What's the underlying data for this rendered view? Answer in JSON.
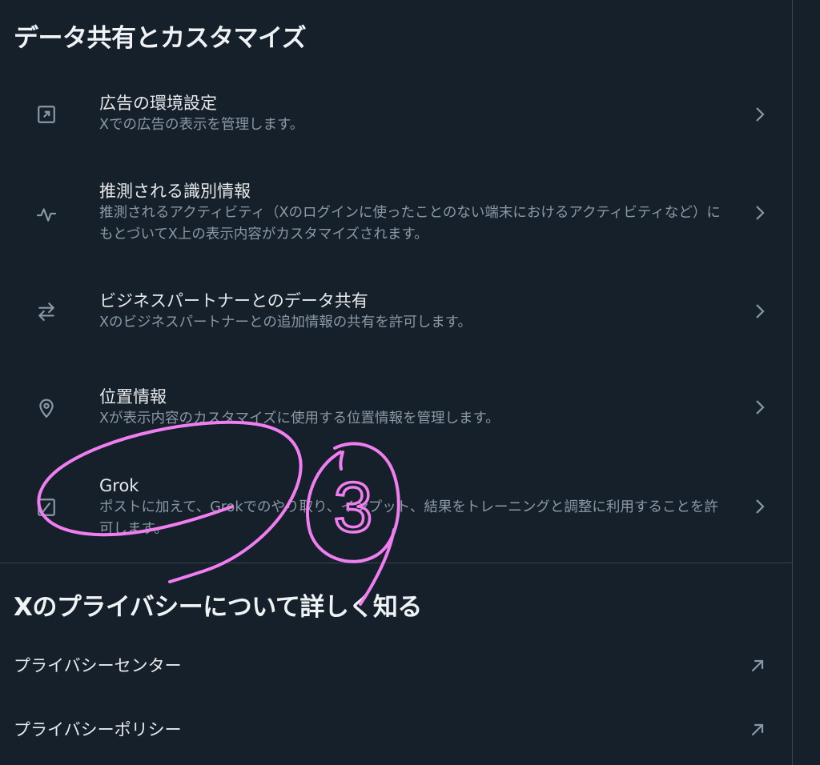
{
  "sections": {
    "data_sharing_title": "データ共有とカスタマイズ",
    "learn_more_title": "Xのプライバシーについて詳しく知る"
  },
  "settings": [
    {
      "title": "広告の環境設定",
      "description": "Xでの広告の表示を管理します。",
      "icon": "ad-frame-icon"
    },
    {
      "title": "推測される識別情報",
      "description": "推測されるアクティビティ（Xのログインに使ったことのない端末におけるアクティビティなど）にもとづいてX上の表示内容がカスタマイズされます。",
      "icon": "activity-icon"
    },
    {
      "title": "ビジネスパートナーとのデータ共有",
      "description": "Xのビジネスパートナーとの追加情報の共有を許可します。",
      "icon": "swap-arrows-icon"
    },
    {
      "title": "位置情報",
      "description": "Xが表示内容のカスタマイズに使用する位置情報を管理します。",
      "icon": "location-pin-icon"
    },
    {
      "title": "Grok",
      "description": "ポストに加えて、Grokでのやり取り、インプット、結果をトレーニングと調整に利用することを許可します。",
      "icon": "grok-icon"
    }
  ],
  "links": [
    {
      "label": "プライバシーセンター",
      "icon": "external-link-icon"
    },
    {
      "label": "プライバシーポリシー",
      "icon": "external-link-icon"
    }
  ],
  "annotation": {
    "number": "3",
    "color": "#f07ef0"
  },
  "colors": {
    "background": "#15202b",
    "text_primary": "#e7e9ea",
    "text_secondary": "#8b98a5",
    "divider": "#38444d"
  }
}
